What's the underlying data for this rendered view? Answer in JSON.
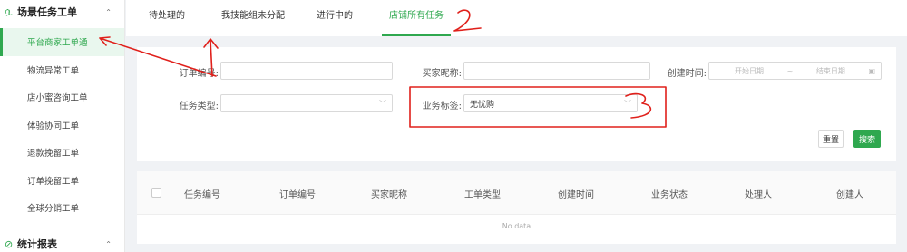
{
  "sidebar": {
    "group_task": "场景任务工单",
    "group_stats": "统计报表",
    "items": [
      "平台商家工单通",
      "物流异常工单",
      "店小蜜咨询工单",
      "体验协同工单",
      "退款挽留工单",
      "订单挽留工单",
      "全球分销工单"
    ]
  },
  "tabs": [
    "待处理的",
    "我技能组未分配",
    "进行中的",
    "店铺所有任务"
  ],
  "filters": {
    "order_no_label": "订单编号:",
    "buyer_nick_label": "买家昵称:",
    "created_time_label": "创建时间:",
    "start_date_placeholder": "开始日期",
    "range_separator": "~",
    "end_date_placeholder": "结束日期",
    "task_type_label": "任务类型:",
    "biz_tag_label": "业务标签:",
    "biz_tag_value": "无忧购"
  },
  "buttons": {
    "reset": "重置",
    "search": "搜索"
  },
  "table": {
    "columns": [
      "任务编号",
      "订单编号",
      "买家昵称",
      "工单类型",
      "创建时间",
      "业务状态",
      "处理人",
      "创建人"
    ],
    "empty_text": "No data"
  },
  "annotations": {
    "color": "#e0201b",
    "labels": [
      "2",
      "3"
    ]
  },
  "colors": {
    "accent": "#2fa84f",
    "annotation": "#e0201b"
  }
}
